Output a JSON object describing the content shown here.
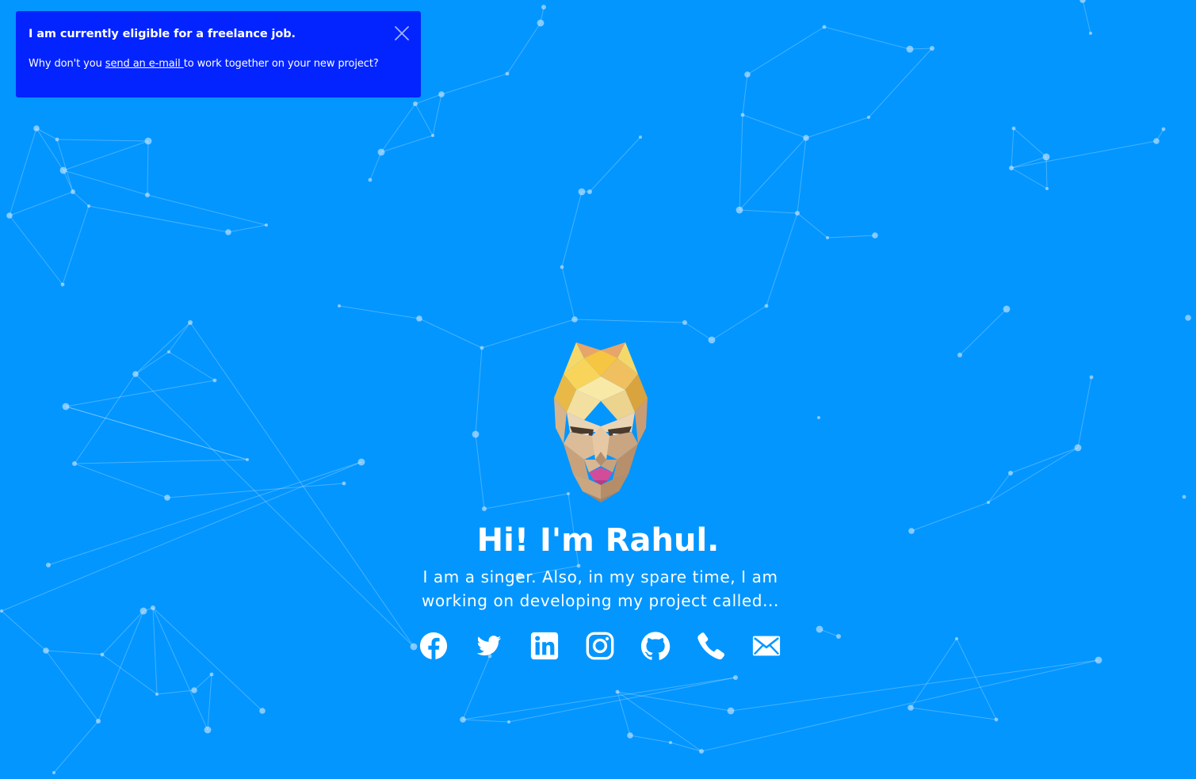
{
  "colors": {
    "background": "#0396ff",
    "toast_background": "#0324ff",
    "text": "#ffffff",
    "network": "#bcdcff"
  },
  "toast": {
    "title": "I am currently eligible for a freelance job.",
    "body_prefix": "Why don't you ",
    "link_text": "send an e-mail ",
    "body_suffix": "to work together on your new project?",
    "close_icon": "close-icon"
  },
  "hero": {
    "avatar": "low-poly-portrait",
    "title": "Hi! I'm Rahul.",
    "subtitle": "I am a singer. Also, in my spare time, I am working on developing my project called..."
  },
  "socials": [
    {
      "name": "facebook-icon"
    },
    {
      "name": "twitter-icon"
    },
    {
      "name": "linkedin-icon"
    },
    {
      "name": "instagram-icon"
    },
    {
      "name": "github-icon"
    },
    {
      "name": "phone-icon"
    },
    {
      "name": "email-icon"
    }
  ]
}
